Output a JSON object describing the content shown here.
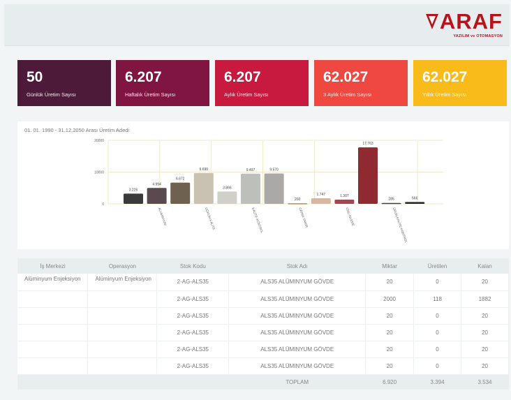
{
  "brand": {
    "logo_text": "ARAF",
    "logo_sub": "YAZILIM ve OTOMASYON",
    "color": "#b5141d"
  },
  "cards": [
    {
      "value": "50",
      "label": "Günlük Üretim Sayısı",
      "color": "#4e1a3a"
    },
    {
      "value": "6.207",
      "label": "Haftalık Üretim Sayısı",
      "color": "#7f1540"
    },
    {
      "value": "6.207",
      "label": "Aylık Üretim Sayısı",
      "color": "#c8193e"
    },
    {
      "value": "62.027",
      "label": "3 Aylık Üretim Sayısı",
      "color": "#ee4840"
    },
    {
      "value": "62.027",
      "label": "Yıllık Üretim Sayısı",
      "color": "#f9bb1a"
    }
  ],
  "chart_title": "01. 01. 1990 - 31.12.2050 Arası Üretim Adedi",
  "chart_data": {
    "type": "bar",
    "ylim": [
      0,
      20000
    ],
    "yticks": [
      "20000",
      "10000",
      "0"
    ],
    "values": [
      3226,
      4994,
      6672,
      9690,
      3866,
      9497,
      9570,
      200,
      1747,
      1307,
      17763,
      285,
      566
    ],
    "data_labels": [
      "3.226",
      "4.994",
      "6.672",
      "9.690",
      "3.866",
      "9.497",
      "9.570",
      "200",
      "1.747",
      "1.307",
      "17.763",
      "285",
      "566"
    ],
    "category_labels": [
      "",
      "ALUMINYUM",
      "",
      "DÖKÜM-KALITE",
      "",
      "KALİTE-KONTROL",
      "",
      "CAPAK-TAMIR",
      "",
      "CNC-ISLEME",
      "",
      "ÜRÜN-KALITE-KONTROL",
      ""
    ],
    "colors": [
      "#3a3a3a",
      "#5a4a4f",
      "#6e6150",
      "#c9c2b3",
      "#d0cfca",
      "#bcbfba",
      "#aaa9a7",
      "#c08d4c",
      "#d8b7a1",
      "#a34655",
      "#8e2a30",
      "#4a3a38",
      "#2a2a2e"
    ]
  },
  "table": {
    "headers": [
      "İş Merkezi",
      "Operasyon",
      "Stok Kodu",
      "Stok Adı",
      "Miktar",
      "Üretilen",
      "Kalan"
    ],
    "rows": [
      [
        "Alüminyum Enjeksiyon",
        "Alüminyum Enjeksiyon",
        "2-AG-ALS35",
        "ALS35 ALÜMINYUM GÖVDE",
        "20",
        "0",
        "20"
      ],
      [
        "",
        "",
        "2-AG-ALS35",
        "ALS35 ALÜMINYUM GÖVDE",
        "2000",
        "118",
        "1882"
      ],
      [
        "",
        "",
        "2-AG-ALS35",
        "ALS35 ALÜMINYUM GÖVDE",
        "20",
        "0",
        "20"
      ],
      [
        "",
        "",
        "2-AG-ALS35",
        "ALS35 ALÜMINYUM GÖVDE",
        "20",
        "0",
        "20"
      ],
      [
        "",
        "",
        "2-AG-ALS35",
        "ALS35 ALÜMINYUM GÖVDE",
        "20",
        "0",
        "20"
      ],
      [
        "",
        "",
        "2-AG-ALS35",
        "ALS35 ALÜMINYUM GÖVDE",
        "20",
        "0",
        "20"
      ]
    ],
    "footer": {
      "label": "TOPLAM",
      "miktar": "6.920",
      "uretilen": "3.394",
      "kalan": "3.534"
    }
  }
}
